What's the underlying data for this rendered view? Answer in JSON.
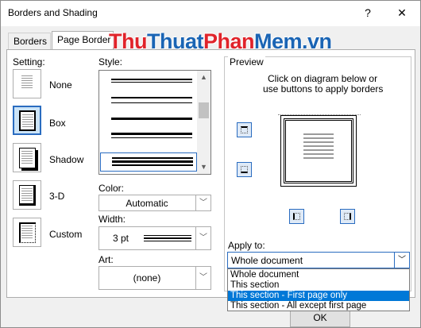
{
  "window": {
    "title": "Borders and Shading",
    "help": "?",
    "close": "✕"
  },
  "tabs": [
    {
      "label": "Borders"
    },
    {
      "label": "Page Border"
    }
  ],
  "watermark": {
    "part1": "Thu",
    "part2": "Thuat",
    "part3": "Phan",
    "part4": "Mem.vn"
  },
  "setting": {
    "label": "Setting:",
    "items": [
      {
        "label": "None",
        "icon": "none-setting-icon"
      },
      {
        "label": "Box",
        "icon": "box-setting-icon"
      },
      {
        "label": "Shadow",
        "icon": "shadow-setting-icon"
      },
      {
        "label": "3-D",
        "icon": "3d-setting-icon"
      },
      {
        "label": "Custom",
        "icon": "custom-setting-icon"
      }
    ]
  },
  "style": {
    "label": "Style:"
  },
  "color": {
    "label": "Color:",
    "value": "Automatic"
  },
  "width": {
    "label": "Width:",
    "value": "3 pt"
  },
  "art": {
    "label": "Art:",
    "value": "(none)"
  },
  "preview": {
    "label": "Preview",
    "hint_line1": "Click on diagram below or",
    "hint_line2": "use buttons to apply borders"
  },
  "apply_to": {
    "label": "Apply to:",
    "value": "Whole document",
    "options": [
      "Whole document",
      "This section",
      "This section - First page only",
      "This section - All except first page"
    ],
    "highlighted": "This section - First page only"
  },
  "buttons": {
    "ok": "OK"
  },
  "colors": {
    "accent": "#0078d7",
    "selection_border": "#2a6cc0",
    "watermark_red": "#e0232a",
    "watermark_blue": "#1a64b4"
  }
}
